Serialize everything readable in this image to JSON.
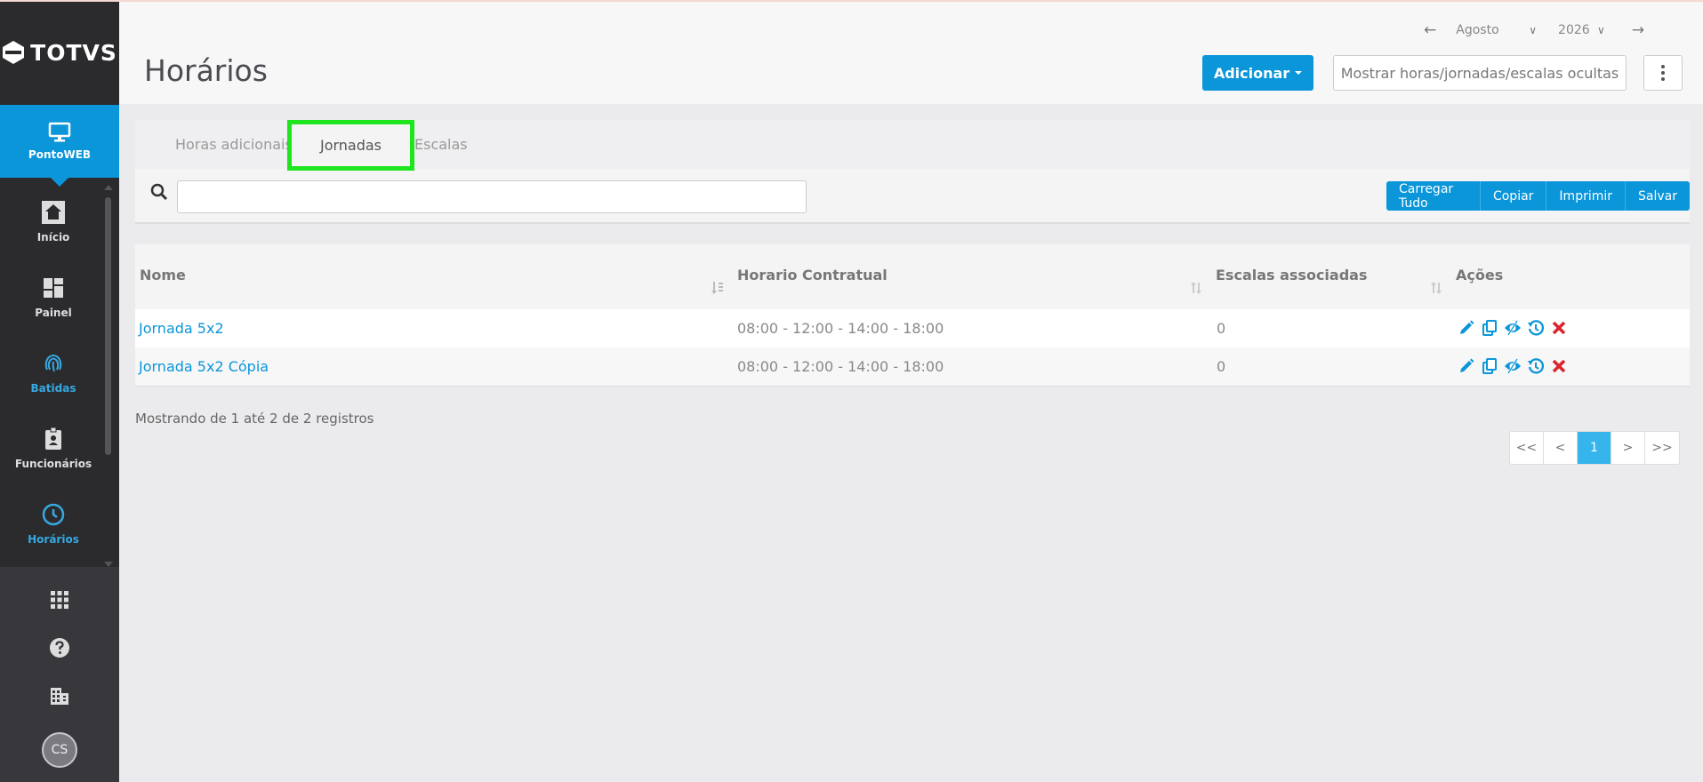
{
  "brand": {
    "logo_text": "TOTVS"
  },
  "app": {
    "name": "PontoWEB"
  },
  "sidebar": {
    "items": [
      {
        "label": "Início",
        "icon": "home-icon"
      },
      {
        "label": "Painel",
        "icon": "dashboard-icon"
      },
      {
        "label": "Batidas",
        "icon": "fingerprint-icon"
      },
      {
        "label": "Funcionários",
        "icon": "badge-icon"
      },
      {
        "label": "Horários",
        "icon": "clock-icon"
      }
    ],
    "bottom": {
      "grid_icon": "apps-grid-icon",
      "help_icon": "help-icon",
      "company_icon": "building-icon",
      "avatar_initials": "CS"
    }
  },
  "header": {
    "title": "Horários",
    "month": "Agosto",
    "year": "2026",
    "add_label": "Adicionar",
    "show_hidden_label": "Mostrar horas/jornadas/escalas ocultas"
  },
  "tabs": [
    {
      "label": "Horas adicionais"
    },
    {
      "label": "Jornadas"
    },
    {
      "label": "Escalas"
    }
  ],
  "toolbar": {
    "search_value": "",
    "buttons": [
      "Carregar Tudo",
      "Copiar",
      "Imprimir",
      "Salvar"
    ]
  },
  "table": {
    "headers": [
      "Nome",
      "Horario Contratual",
      "Escalas associadas",
      "Ações"
    ],
    "rows": [
      {
        "name": "Jornada 5x2",
        "schedule": "08:00 - 12:00 - 14:00 - 18:00",
        "count": "0"
      },
      {
        "name": "Jornada 5x2 Cópia",
        "schedule": "08:00 - 12:00 - 14:00 - 18:00",
        "count": "0"
      }
    ],
    "action_icons": [
      "edit-icon",
      "copy-icon",
      "hide-icon",
      "history-icon",
      "delete-icon"
    ]
  },
  "footer": {
    "info": "Mostrando de 1 até 2 de 2 registros",
    "pages": [
      "<<",
      "<",
      "1",
      ">",
      ">>"
    ]
  },
  "colors": {
    "primary": "#0a96d9",
    "sidebar": "#2b2b2e",
    "highlight_border": "#1ee51e",
    "delete": "#d9252b"
  }
}
